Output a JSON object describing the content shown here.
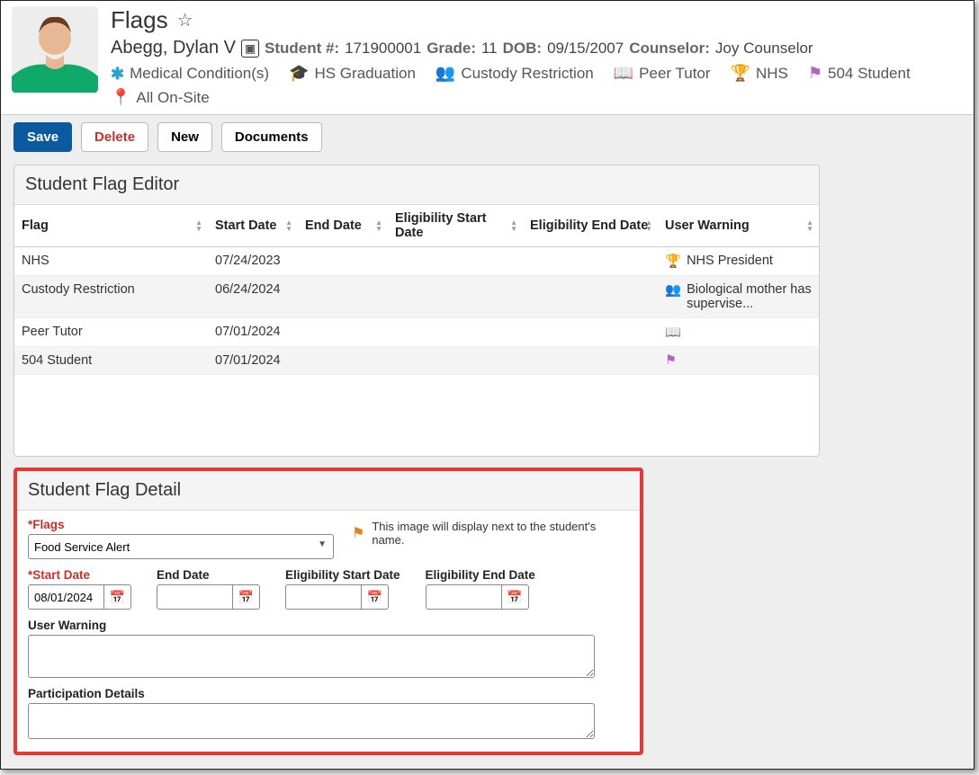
{
  "page": {
    "title": "Flags"
  },
  "student": {
    "name": "Abegg, Dylan V",
    "student_number_label": "Student #:",
    "student_number": "171900001",
    "grade_label": "Grade:",
    "grade": "11",
    "dob_label": "DOB:",
    "dob": "09/15/2007",
    "counselor_label": "Counselor:",
    "counselor": "Joy Counselor"
  },
  "flags_bar": {
    "medical": "Medical Condition(s)",
    "graduation": "HS Graduation",
    "custody": "Custody Restriction",
    "peer_tutor": "Peer Tutor",
    "nhs": "NHS",
    "student504": "504 Student",
    "onsite": "All On-Site"
  },
  "actions": {
    "save": "Save",
    "delete": "Delete",
    "new": "New",
    "documents": "Documents"
  },
  "editor": {
    "title": "Student Flag Editor",
    "columns": {
      "flag": "Flag",
      "start": "Start Date",
      "end": "End Date",
      "elig_start": "Eligibility Start Date",
      "elig_end": "Eligibility End Date",
      "warning": "User Warning"
    },
    "rows": [
      {
        "flag": "NHS",
        "start": "07/24/2023",
        "end": "",
        "es": "",
        "ee": "",
        "icon": "trophy",
        "icon_color": "#5bc0c0",
        "warning": "NHS President"
      },
      {
        "flag": "Custody Restriction",
        "start": "06/24/2024",
        "end": "",
        "es": "",
        "ee": "",
        "icon": "people",
        "icon_color": "#d9534f",
        "warning": "Biological mother has supervise..."
      },
      {
        "flag": "Peer Tutor",
        "start": "07/01/2024",
        "end": "",
        "es": "",
        "ee": "",
        "icon": "book",
        "icon_color": "#2e7d32",
        "warning": ""
      },
      {
        "flag": "504 Student",
        "start": "07/01/2024",
        "end": "",
        "es": "",
        "ee": "",
        "icon": "flag",
        "icon_color": "#b85fc2",
        "warning": ""
      }
    ]
  },
  "detail": {
    "title": "Student Flag Detail",
    "flags_label": "*Flags",
    "flags_value": "Food Service Alert",
    "hint": "This image will display next to the student's name.",
    "start_label": "*Start Date",
    "start_value": "08/01/2024",
    "end_label": "End Date",
    "end_value": "",
    "elig_start_label": "Eligibility Start Date",
    "elig_start_value": "",
    "elig_end_label": "Eligibility End Date",
    "elig_end_value": "",
    "user_warning_label": "User Warning",
    "user_warning_value": "",
    "participation_label": "Participation Details",
    "participation_value": ""
  }
}
